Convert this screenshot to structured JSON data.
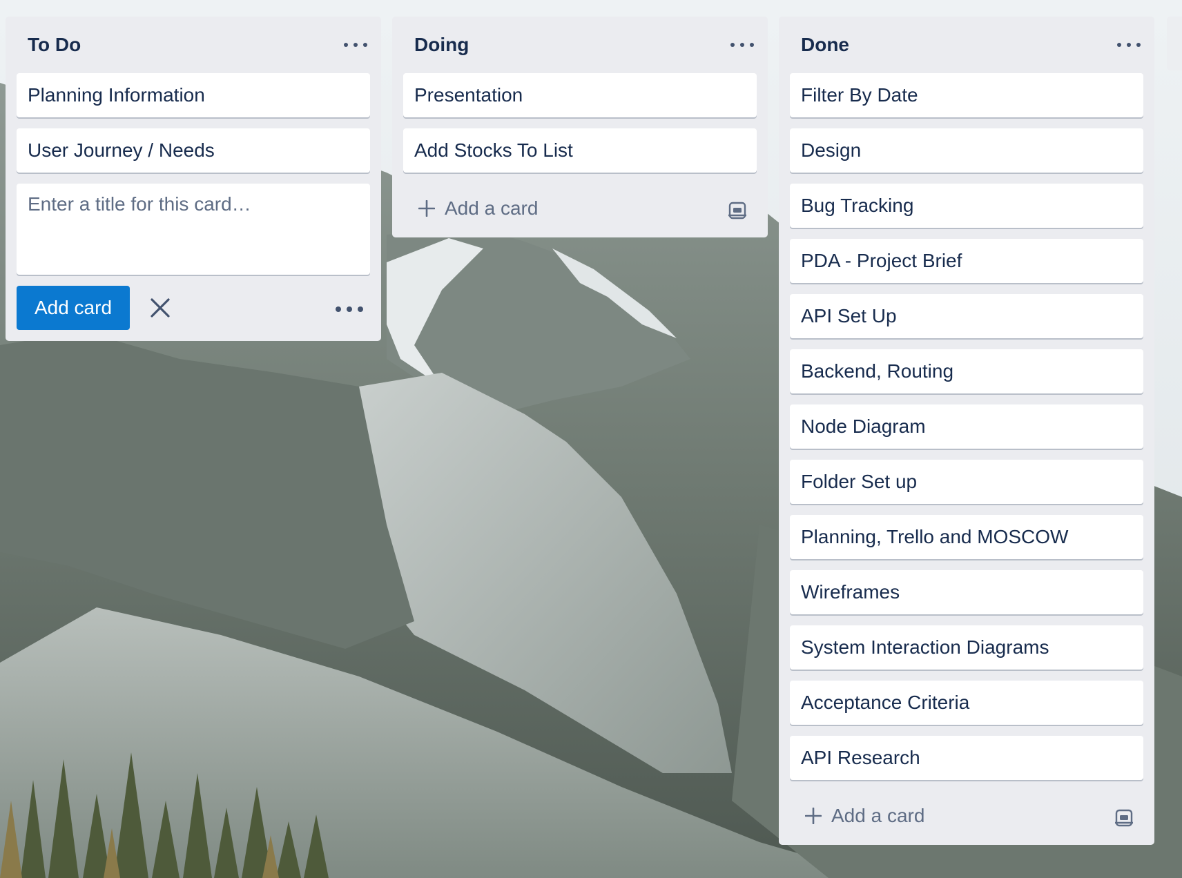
{
  "board": {
    "lists": [
      {
        "title": "To Do",
        "cards": [
          "Planning Information",
          "User Journey / Needs"
        ],
        "composer": {
          "placeholder": "Enter a title for this card…",
          "add_button": "Add card"
        }
      },
      {
        "title": "Doing",
        "cards": [
          "Presentation",
          "Add Stocks To List"
        ],
        "add_card_label": "Add a card"
      },
      {
        "title": "Done",
        "cards": [
          "Filter By Date",
          "Design",
          "Bug Tracking",
          "PDA - Project Brief",
          "API Set Up",
          "Backend, Routing",
          "Node Diagram",
          "Folder Set up",
          "Planning, Trello and MOSCOW",
          "Wireframes",
          "System Interaction Diagrams",
          "Acceptance Criteria",
          "API Research"
        ],
        "add_card_label": "Add a card"
      }
    ]
  },
  "icons": {
    "list_menu": "ellipsis-icon",
    "add": "plus-icon",
    "close": "close-icon",
    "template": "card-template-icon"
  },
  "colors": {
    "list_background": "#ebecf0",
    "card_background": "#ffffff",
    "primary_button": "#0b79d0",
    "text": "#172b4d",
    "muted_text": "#5e6c84"
  }
}
